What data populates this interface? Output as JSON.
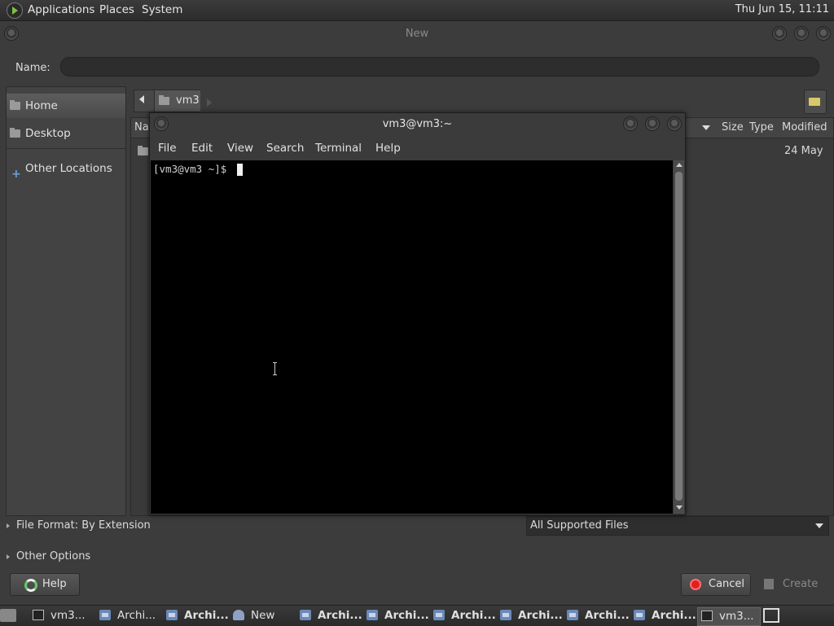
{
  "top_panel": {
    "menus": [
      "Applications",
      "Places",
      "System"
    ],
    "clock": "Thu Jun 15, 11:11"
  },
  "dialog": {
    "title": "New",
    "name_label": "Name:",
    "name_value": "",
    "sidebar": {
      "items": [
        {
          "label": "Home",
          "icon": "home-folder-icon",
          "selected": true
        },
        {
          "label": "Desktop",
          "icon": "desktop-folder-icon",
          "selected": false
        },
        {
          "label": "Other Locations",
          "icon": "plus-icon",
          "selected": false
        }
      ]
    },
    "pathbar": {
      "crumb": "vm3"
    },
    "columns": {
      "name": "Na",
      "size": "Size",
      "type": "Type",
      "modified": "Modified"
    },
    "rows": [
      {
        "modified": "24 May"
      }
    ],
    "file_format_label": "File Format: By Extension",
    "filter_value": "All Supported Files",
    "other_options_label": "Other Options",
    "buttons": {
      "help": "Help",
      "cancel": "Cancel",
      "create": "Create"
    }
  },
  "terminal": {
    "title": "vm3@vm3:~",
    "menu": [
      "File",
      "Edit",
      "View",
      "Search",
      "Terminal",
      "Help"
    ],
    "prompt": "[vm3@vm3 ~]$ "
  },
  "taskbar": {
    "tasks": [
      {
        "label": "vm3...",
        "icon": "terminal-icon",
        "bold": false
      },
      {
        "label": "Archi...",
        "icon": "archive-icon",
        "bold": false
      },
      {
        "label": "Archi...",
        "icon": "archive-icon",
        "bold": true
      },
      {
        "label": "New",
        "icon": "new-doc-icon",
        "bold": false
      },
      {
        "label": "Archi...",
        "icon": "archive-icon",
        "bold": true
      },
      {
        "label": "Archi...",
        "icon": "archive-icon",
        "bold": true
      },
      {
        "label": "Archi...",
        "icon": "archive-icon",
        "bold": true
      },
      {
        "label": "Archi...",
        "icon": "archive-icon",
        "bold": true
      },
      {
        "label": "Archi...",
        "icon": "archive-icon",
        "bold": true
      },
      {
        "label": "Archi...",
        "icon": "archive-icon",
        "bold": true
      },
      {
        "label": "vm3...",
        "icon": "terminal-icon",
        "bold": false
      }
    ]
  }
}
